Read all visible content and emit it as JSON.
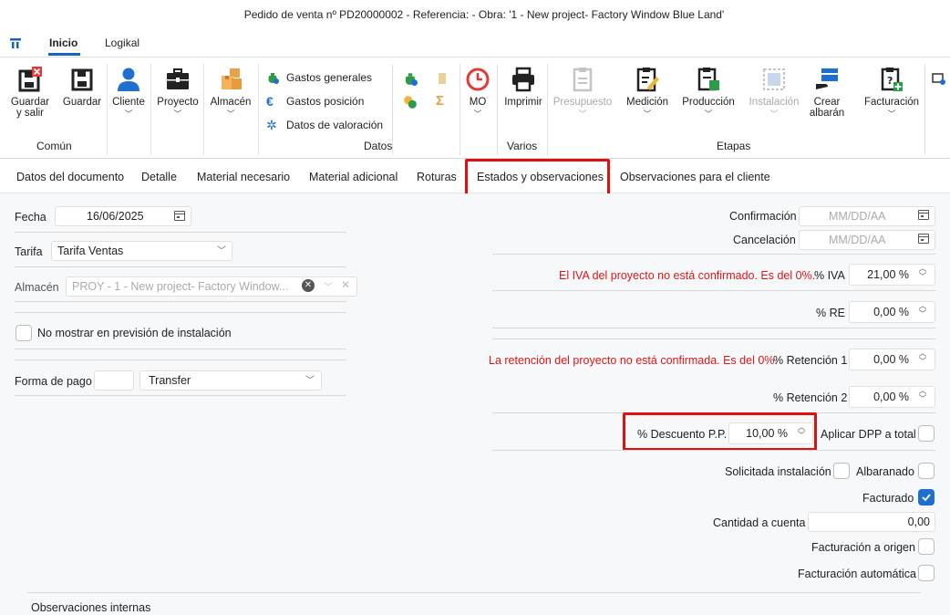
{
  "window": {
    "title": "Pedido de venta nº PD20000002 - Referencia:  - Obra: '1 - New project- Factory Window Blue Land'"
  },
  "menu": {
    "tabs": [
      {
        "label": "Inicio",
        "active": true
      },
      {
        "label": "Logikal",
        "active": false
      }
    ]
  },
  "ribbon": {
    "groups": {
      "comun": "Común",
      "datos": "Datos",
      "varios": "Varios",
      "etapas": "Etapas"
    },
    "buttons": {
      "guardar_salir": "Guardar\ny salir",
      "guardar": "Guardar",
      "cliente": "Cliente",
      "proyecto": "Proyecto",
      "almacen": "Almacén",
      "mo": "MO",
      "imprimir": "Imprimir",
      "presupuesto": "Presupuesto",
      "medicion": "Medición",
      "produccion": "Producción",
      "instalacion": "Instalación",
      "crear_albaran": "Crear\nalbarán",
      "facturacion": "Facturación"
    },
    "datos_items": {
      "gastos_generales": "Gastos generales",
      "gastos_posicion": "Gastos posición",
      "datos_valoracion": "Datos de valoración"
    }
  },
  "tabs": [
    {
      "label": "Datos del documento"
    },
    {
      "label": "Detalle"
    },
    {
      "label": "Material necesario"
    },
    {
      "label": "Material adicional"
    },
    {
      "label": "Roturas"
    },
    {
      "label": "Estados y observaciones",
      "active": true
    },
    {
      "label": "Observaciones para el cliente"
    }
  ],
  "left": {
    "fecha_label": "Fecha",
    "fecha_value": "16/06/2025",
    "tarifa_label": "Tarifa",
    "tarifa_value": "Tarifa Ventas",
    "almacen_label": "Almacén",
    "almacen_value": "PROY - 1 - New project- Factory Window...",
    "no_mostrar_label": "No mostrar en previsión de instalación",
    "forma_pago_label": "Forma de pago",
    "forma_pago_value": "Transfer"
  },
  "right": {
    "confirmacion_label": "Confirmación",
    "confirmacion_placeholder": "MM/DD/AA",
    "cancelacion_label": "Cancelación",
    "cancelacion_placeholder": "MM/DD/AA",
    "iva_warning": "El IVA del proyecto no está confirmado. Es del 0%.",
    "iva_label": "% IVA",
    "iva_value": "21,00 %",
    "re_label": "% RE",
    "re_value": "0,00 %",
    "retencion_warning": "La retención del proyecto no está confirmada. Es del 0%.",
    "retencion1_label": "% Retención 1",
    "retencion1_value": "0,00 %",
    "retencion2_label": "% Retención 2",
    "retencion2_value": "0,00 %",
    "descuento_label": "% Descuento P.P.",
    "descuento_value": "10,00 %",
    "aplicar_dpp_label": "Aplicar DPP a total",
    "solicitada_label": "Solicitada instalación",
    "albaranado_label": "Albaranado",
    "facturado_label": "Facturado",
    "cantidad_label": "Cantidad a cuenta",
    "cantidad_value": "0,00",
    "fact_origen_label": "Facturación a origen",
    "fact_auto_label": "Facturación automática"
  },
  "bottom": {
    "observaciones_label": "Observaciones internas"
  },
  "colors": {
    "accent": "#1e6fd0",
    "highlight": "#e01010",
    "warning": "#e01515"
  }
}
